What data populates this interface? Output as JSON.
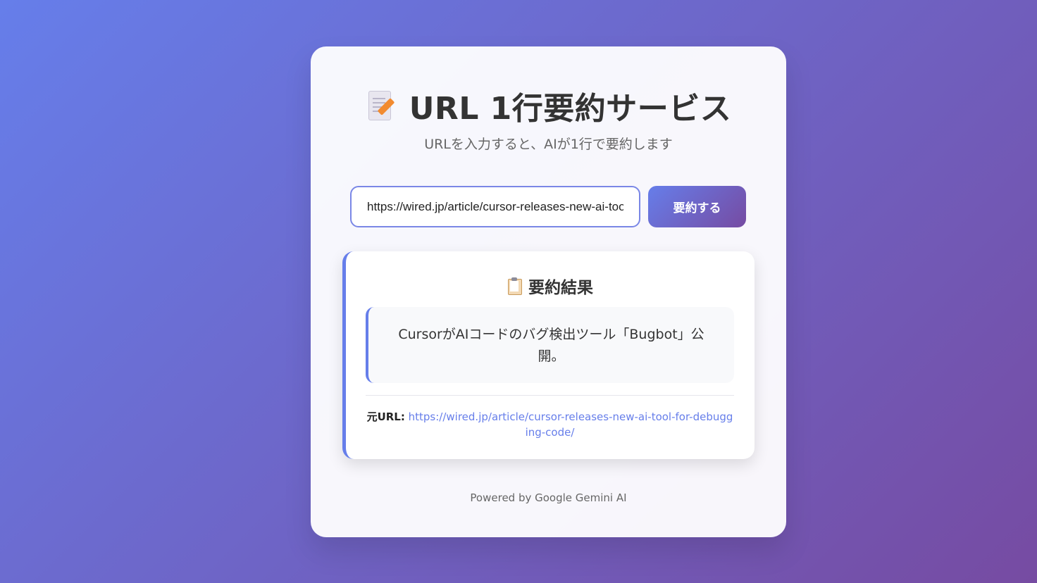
{
  "app": {
    "title": "URL 1行要約サービス",
    "subtitle": "URLを入力すると、AIが1行で要約します",
    "title_icon": "memo-icon"
  },
  "form": {
    "url_value": "https://wired.jp/article/cursor-releases-new-ai-tool-for-debugging-code/",
    "submit_label": "要約する"
  },
  "result": {
    "heading": "要約結果",
    "heading_icon": "clipboard-icon",
    "summary": "CursorがAIコードのバグ検出ツール「Bugbot」公開。",
    "source_label": "元URL:",
    "source_url": "https://wired.jp/article/cursor-releases-new-ai-tool-for-debugging-code/"
  },
  "footer": {
    "text": "Powered by Google Gemini AI"
  },
  "colors": {
    "accent": "#667eea",
    "accent_end": "#764ba2",
    "text": "#333333",
    "muted": "#666666"
  }
}
